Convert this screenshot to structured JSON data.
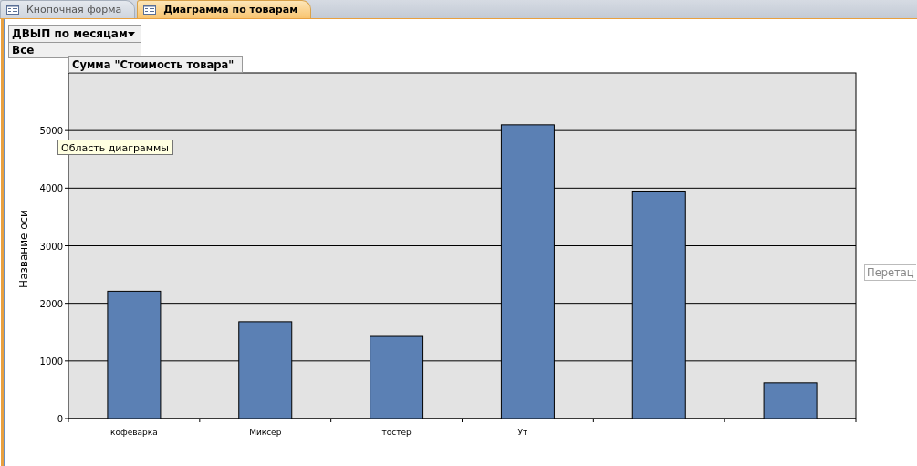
{
  "tabs": [
    {
      "label": "Кнопочная форма",
      "selected": false
    },
    {
      "label": "Диаграмма по товарам",
      "selected": true
    }
  ],
  "filter": {
    "field": "ДВЫП по месяцам",
    "value": "Все"
  },
  "chart": {
    "tooltip": "Область диаграммы",
    "drop_zone": "Перетац",
    "chart_data": {
      "type": "bar",
      "title": "Сумма \"Стоимость товара\"",
      "ylabel": "Название оси",
      "categories": [
        "кофеварка",
        "Миксер",
        "тостер",
        "Ут",
        null,
        null
      ],
      "series": [
        {
          "color": "#5b80b4",
          "values": [
            2210,
            1680,
            1440,
            5100,
            3950,
            620
          ]
        }
      ],
      "grid": true,
      "ylim": [
        0,
        6000
      ],
      "yticks": [
        0,
        1000,
        2000,
        3000,
        4000,
        5000
      ]
    }
  }
}
